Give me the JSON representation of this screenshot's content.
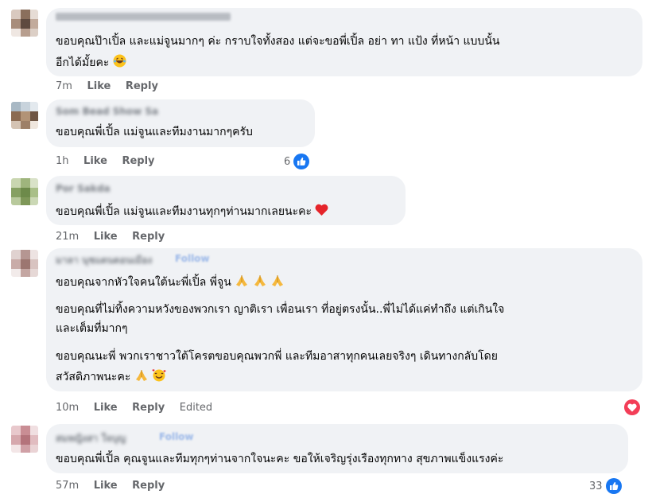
{
  "common": {
    "like": "Like",
    "reply": "Reply",
    "edited": "Edited"
  },
  "comments": [
    {
      "author": "นุช สุดสวย",
      "lines": [
        "ขอบคุณป๊าเปิ้ล และแม่จูนมากๆ ค่ะ กราบใจทั้งสอง แต่จะขอพี่เปิ้ล อย่า ทา แป้ง ที่หน้า แบบนั้น",
        "อีกได้มั้ยคะ"
      ],
      "time": "7m"
    },
    {
      "author": "Som Bead Show Sa",
      "lines": [
        "ขอบคุณพี่เปิ้ล แม่จูนและทีมงานมากๆครับ"
      ],
      "time": "1h",
      "reactions": "6"
    },
    {
      "author": "Por Sakda",
      "lines": [
        "ขอบคุณพี่เปิ้ล แม่จูนและทีมงานทุกๆท่านมากเลยนะคะ"
      ],
      "time": "21m"
    },
    {
      "author": "มาลา นุชแดนดอนเมือง",
      "follow": "Follow",
      "lines": [
        "ขอบคุณจากหัวใจคนใต้นะพี่เปิ้ล พี่จูน",
        "ขอบคุณที่ไม่ทิ้งความหวังของพวกเรา ญาติเรา เพื่อนเรา ที่อยู่ตรงนั้น..พี่ไม่ได้แค่ทำถึง แต่เกินใจ",
        "และเต็มที่มากๆ",
        "ขอบคุณนะพี่ พวกเราชาวใต้โครตขอบคุณพวกพี่ และทีมอาสาทุกคนเลยจริงๆ เดินทางกลับโดย",
        "สวัสดิภาพนะคะ"
      ],
      "time": "10m"
    },
    {
      "author": "สมหญิงสา ใจบุญ",
      "follow": "Follow",
      "lines": [
        "ขอบคุณพี่เปิ้ล คุณจูนและทีมทุกๆท่านจากใจนะคะ ขอให้เจริญรุ่งเรืองทุกทาง สุขภาพแข็งแรงค่ะ"
      ],
      "time": "57m",
      "reactions": "33"
    }
  ],
  "icons": {
    "laugh": "laughing-emoji-icon",
    "heart": "red-heart-emoji-icon",
    "pray": "folded-hands-emoji-icon",
    "hearts_face": "smiling-face-with-hearts-emoji-icon",
    "like_badge": "like-reaction-icon",
    "love_badge": "love-reaction-icon"
  },
  "colors": {
    "bubble": "#f0f2f5",
    "action_text": "#65676b",
    "like_blue": "#1877f2",
    "love_red": "#f33e58"
  }
}
